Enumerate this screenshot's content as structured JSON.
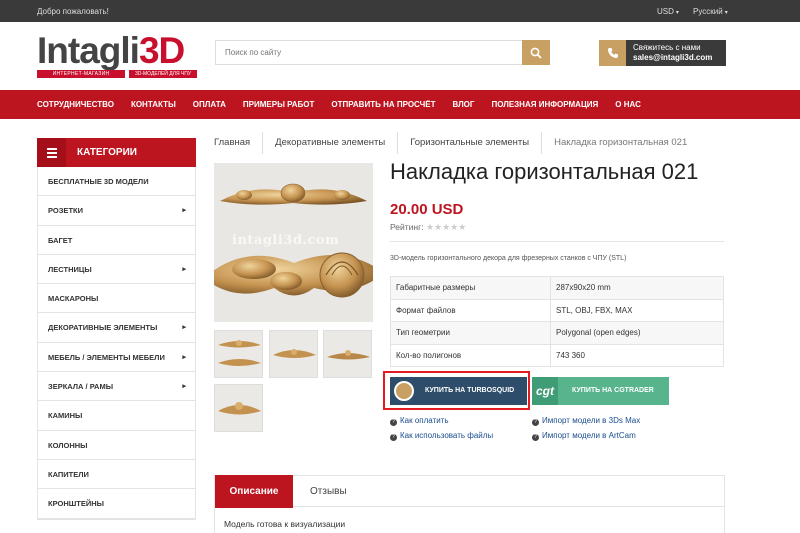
{
  "topbar": {
    "welcome": "Добро пожаловать!",
    "currency": "USD",
    "language": "Русский"
  },
  "header": {
    "logo_main": "Intagli",
    "logo_accent": "3D",
    "logo_tag1": "ИНТЕРНЕТ-МАГАЗИН",
    "logo_tag2": "3D-МОДЕЛЕЙ ДЛЯ ЧПУ",
    "search_placeholder": "Поиск по сайту",
    "contact_label": "Свяжитесь с нами",
    "contact_email": "sales@intagli3d.com"
  },
  "nav": {
    "items": [
      "СОТРУДНИЧЕСТВО",
      "КОНТАКТЫ",
      "ОПЛАТА",
      "ПРИМЕРЫ РАБОТ",
      "ОТПРАВИТЬ НА ПРОСЧЁТ",
      "ВЛОГ",
      "ПОЛЕЗНАЯ ИНФОРМАЦИЯ",
      "О НАС"
    ]
  },
  "sidebar": {
    "title": "КАТЕГОРИИ",
    "items": [
      {
        "label": "БЕСПЛАТНЫЕ 3D МОДЕЛИ",
        "has_sub": false
      },
      {
        "label": "РОЗЕТКИ",
        "has_sub": true
      },
      {
        "label": "БАГЕТ",
        "has_sub": false
      },
      {
        "label": "ЛЕСТНИЦЫ",
        "has_sub": true
      },
      {
        "label": "МАСКАРОНЫ",
        "has_sub": false
      },
      {
        "label": "ДЕКОРАТИВНЫЕ ЭЛЕМЕНТЫ",
        "has_sub": true
      },
      {
        "label": "МЕБЕЛЬ / ЭЛЕМЕНТЫ МЕБЕЛИ",
        "has_sub": true
      },
      {
        "label": "ЗЕРКАЛА / РАМЫ",
        "has_sub": true
      },
      {
        "label": "КАМИНЫ",
        "has_sub": false
      },
      {
        "label": "КОЛОННЫ",
        "has_sub": false
      },
      {
        "label": "КАПИТЕЛИ",
        "has_sub": false
      },
      {
        "label": "КРОНШТЕЙНЫ",
        "has_sub": false
      }
    ]
  },
  "breadcrumb": [
    "Главная",
    "Декоративные элементы",
    "Горизонтальные элементы",
    "Накладка горизонтальная 021"
  ],
  "product": {
    "title": "Накладка горизонтальная 021",
    "price": "20.00 USD",
    "rating_label": "Рейтинг:",
    "rating_value": 0,
    "watermark": "intagli3d.com",
    "description": "3D-модель горизонтального декора для фрезерных станков с ЧПУ (STL)",
    "specs": [
      {
        "key": "Габаритные размеры",
        "value": "287x90x20 mm"
      },
      {
        "key": "Формат файлов",
        "value": "STL, OBJ, FBX, MAX"
      },
      {
        "key": "Тип геометрии",
        "value": "Polygonal (open edges)"
      },
      {
        "key": "Кол-во полигонов",
        "value": "743 360"
      }
    ],
    "buy_turbosquid": "КУПИТЬ НА TURBOSQUID",
    "buy_cgtrader": "КУПИТЬ НА CGTRADER",
    "cgt_logo": "cgt",
    "links": [
      "Как оплатить",
      "Как использовать файлы",
      "Импорт модели в 3Ds Max",
      "Импорт модели в ArtCam"
    ]
  },
  "tabs": {
    "active": "Описание",
    "other": "Отзывы",
    "content": "Модель готова к визуализации"
  },
  "colors": {
    "brand_red": "#bd1520",
    "gold": "#c9a063",
    "dark": "#3a3a3a",
    "turbosquid": "#2e4d6b",
    "cgtrader": "#57b48c"
  }
}
